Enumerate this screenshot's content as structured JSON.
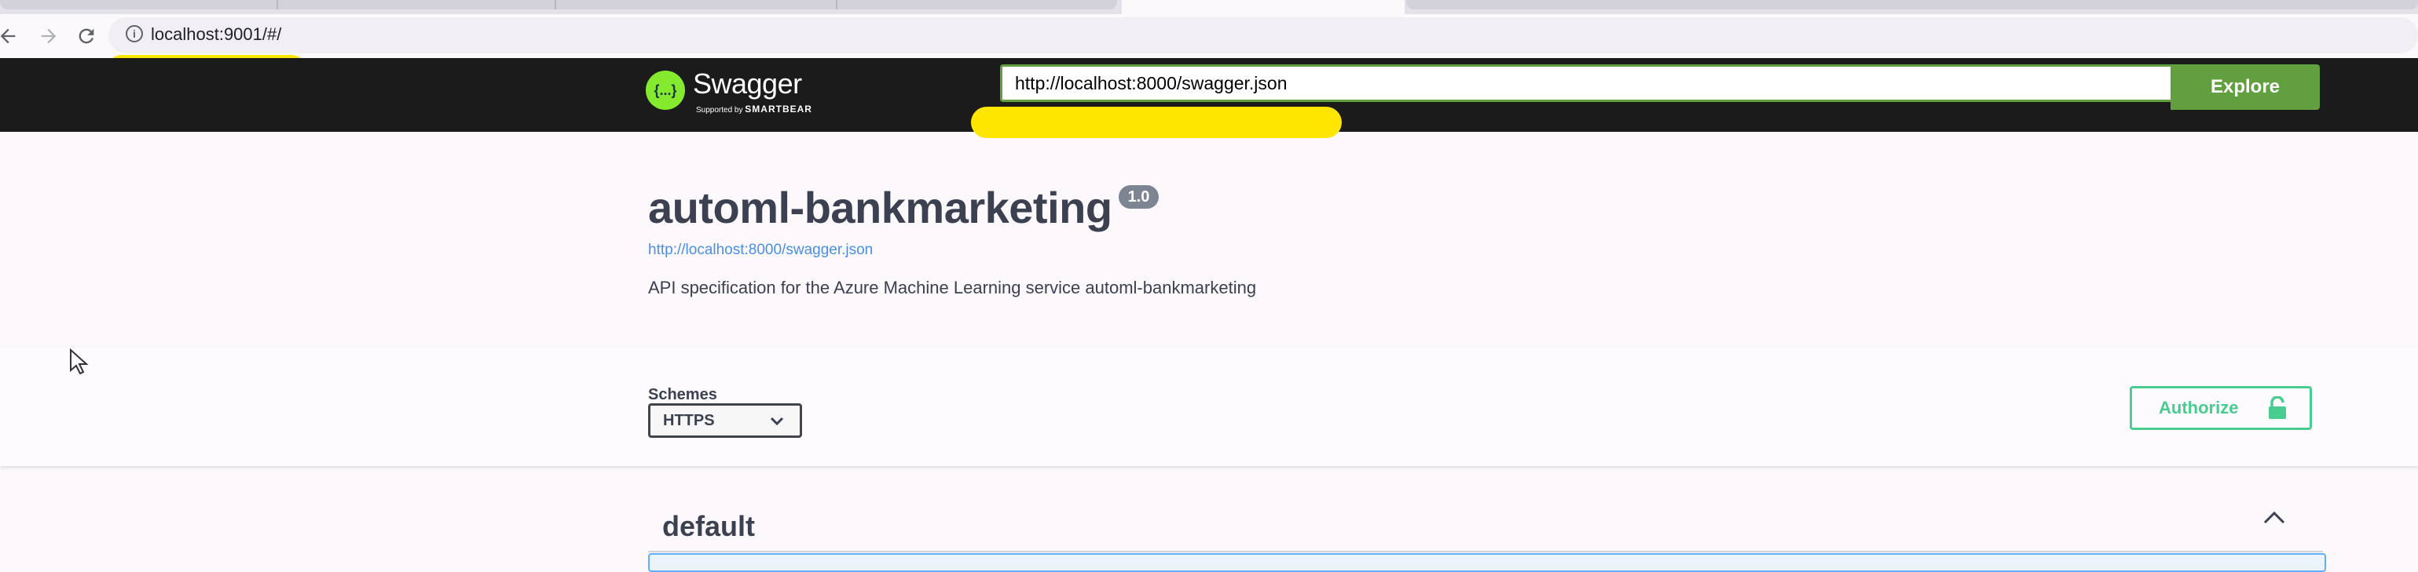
{
  "browser": {
    "url": "localhost:9001/#/",
    "nav": {
      "back_icon": "arrow-left-icon",
      "forward_icon": "arrow-right-icon",
      "reload_icon": "reload-icon",
      "info_icon": "info-icon"
    }
  },
  "topbar": {
    "logo_name": "Swagger",
    "logo_tagline": "Supported by",
    "logo_brand": "SMARTBEAR",
    "logo_symbol": "{...}",
    "spec_url_value": "http://localhost:8000/swagger.json",
    "explore_label": "Explore"
  },
  "info": {
    "title": "automl-bankmarketing",
    "version": "1.0",
    "spec_link": "http://localhost:8000/swagger.json",
    "description": "API specification for the Azure Machine Learning service automl-bankmarketing"
  },
  "schemes": {
    "label": "Schemes",
    "selected": "HTTPS",
    "options": [
      "HTTPS"
    ]
  },
  "authorize": {
    "label": "Authorize",
    "icon": "lock-icon"
  },
  "tags": [
    {
      "name": "default",
      "expanded": true
    }
  ],
  "colors": {
    "topbar_bg": "#1b1b1b",
    "swagger_green": "#62a03f",
    "logo_green": "#85ea2d",
    "authorize_green": "#49cc90",
    "link_blue": "#4990e2",
    "redaction_yellow": "#ffe600"
  }
}
